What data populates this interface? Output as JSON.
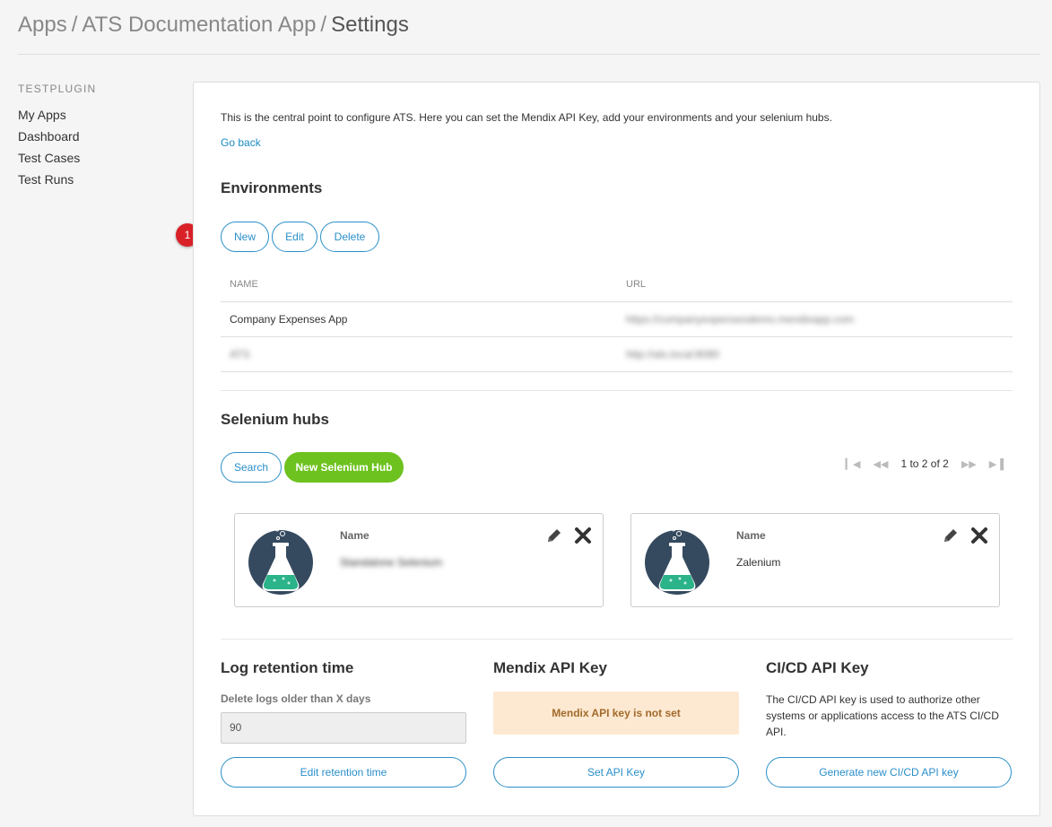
{
  "breadcrumb": {
    "items": [
      "Apps",
      "ATS Documentation App",
      "Settings"
    ],
    "separator": "/"
  },
  "sidebar": {
    "heading": "TESTPLUGIN",
    "items": [
      {
        "label": "My Apps"
      },
      {
        "label": "Dashboard"
      },
      {
        "label": "Test Cases"
      },
      {
        "label": "Test Runs"
      }
    ]
  },
  "intro": "This is the central point to configure ATS. Here you can set the Mendix API Key, add your environments and your selenium hubs.",
  "go_back": "Go back",
  "environments": {
    "title": "Environments",
    "buttons": {
      "new": "New",
      "edit": "Edit",
      "delete": "Delete"
    },
    "columns": [
      "NAME",
      "URL"
    ],
    "rows": [
      {
        "name": "Company Expenses App",
        "url": "https://companyexpensesdemo.mendixapp.com"
      },
      {
        "name": "ATS",
        "url": "http://ats.local:8080"
      }
    ]
  },
  "selenium_hubs": {
    "title": "Selenium hubs",
    "search_label": "Search",
    "new_label": "New Selenium Hub",
    "pagination": "1 to 2 of 2",
    "cards": [
      {
        "label": "Name",
        "value": "Standalone Selenium"
      },
      {
        "label": "Name",
        "value": "Zalenium"
      }
    ]
  },
  "log_retention": {
    "title": "Log retention time",
    "field_label": "Delete logs older than X days",
    "value": "90",
    "button": "Edit retention time"
  },
  "mendix_api": {
    "title": "Mendix API Key",
    "warning": "Mendix API key is not set",
    "button": "Set API Key"
  },
  "cicd_api": {
    "title": "CI/CD API Key",
    "description": "The CI/CD API key is used to authorize other systems or applications access to the ATS CI/CD API.",
    "button": "Generate new CI/CD API key"
  },
  "annotation_marker": "1",
  "colors": {
    "accent": "#2a8fc9",
    "green": "#6ec21f",
    "warning_bg": "#fde9d2",
    "marker": "#d92027"
  }
}
